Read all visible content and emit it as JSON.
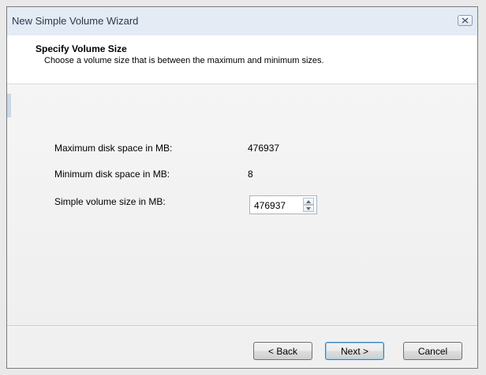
{
  "window": {
    "title": "New Simple Volume Wizard"
  },
  "header": {
    "title": "Specify Volume Size",
    "subtitle": "Choose a volume size that is between the maximum and minimum sizes."
  },
  "fields": {
    "max_label": "Maximum disk space in MB:",
    "max_value": "476937",
    "min_label": "Minimum disk space in MB:",
    "min_value": "8",
    "size_label": "Simple volume size in MB:",
    "size_value": "476937"
  },
  "buttons": {
    "back": "< Back",
    "next": "Next >",
    "cancel": "Cancel"
  },
  "icons": {
    "close": "close-icon",
    "spin_up": "spin-up-arrow-icon",
    "spin_down": "spin-down-arrow-icon"
  }
}
